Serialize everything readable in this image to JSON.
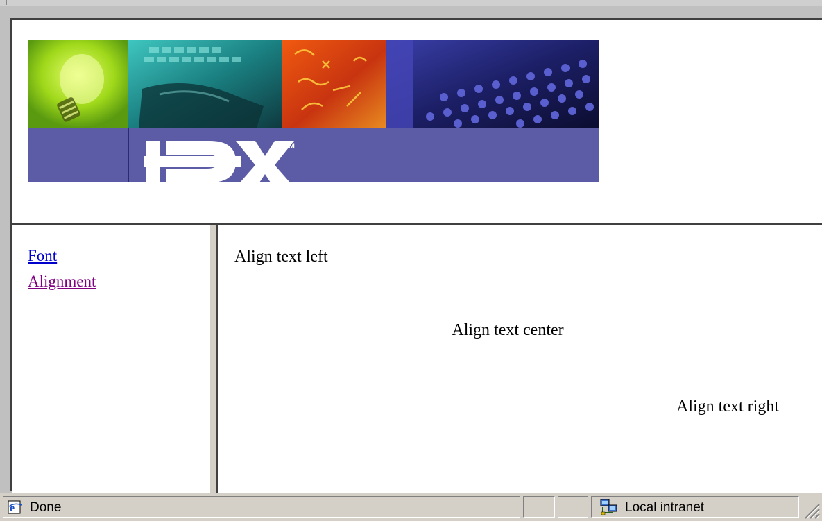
{
  "banner": {
    "logo_text": "IDX",
    "trademark": "TM"
  },
  "nav": {
    "links": [
      {
        "label": "Font"
      },
      {
        "label": "Alignment"
      }
    ]
  },
  "main": {
    "align_left": "Align text left",
    "align_center": "Align text center",
    "align_right": "Align text right"
  },
  "status": {
    "text": "Done",
    "zone": "Local intranet"
  },
  "colors": {
    "link": "#0000cc",
    "visited_link": "#800080",
    "banner_purple": "#5b5ba6",
    "chrome": "#d4d0c8"
  }
}
